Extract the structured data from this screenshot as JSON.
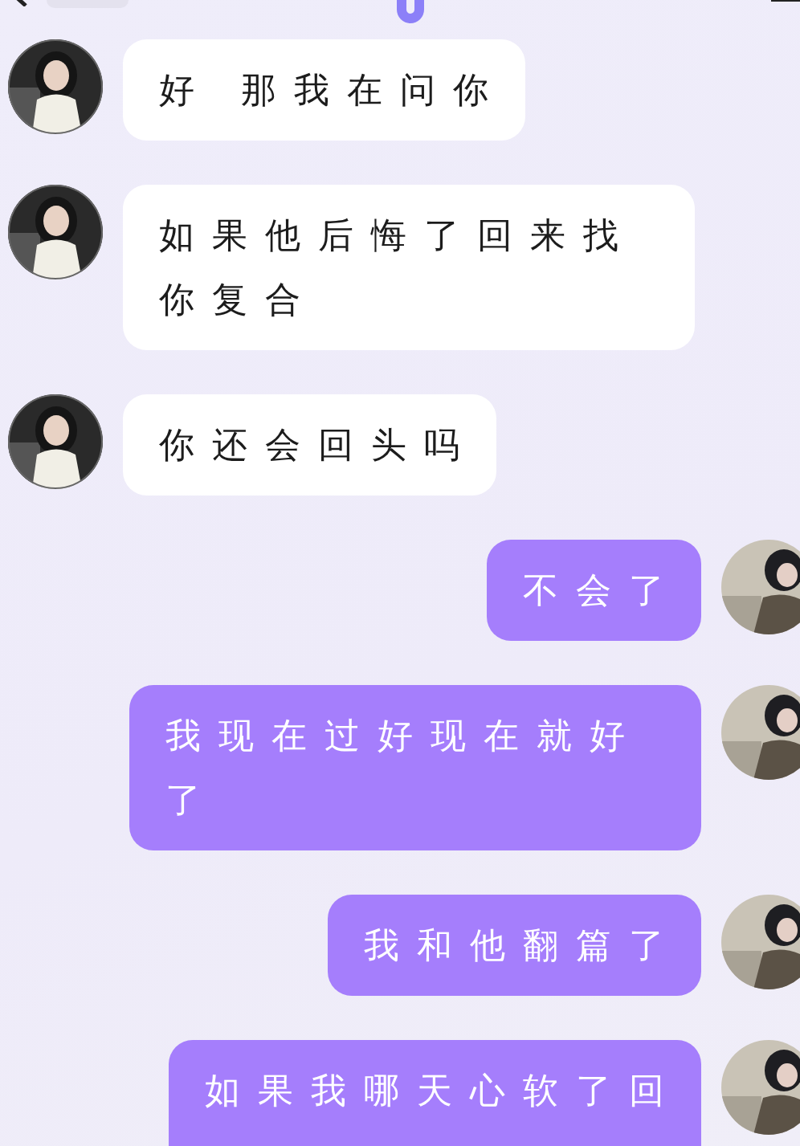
{
  "messages": [
    {
      "kind": "incoming",
      "text": "好 那我在问你",
      "cut_off": false
    },
    {
      "kind": "incoming",
      "text": "如果他后悔了回来找你复合",
      "cut_off": false
    },
    {
      "kind": "incoming",
      "text": "你还会回头吗",
      "cut_off": false
    },
    {
      "kind": "outgoing",
      "text": "不会了",
      "cut_off": false
    },
    {
      "kind": "outgoing",
      "text": "我现在过好现在就好了",
      "cut_off": false
    },
    {
      "kind": "outgoing",
      "text": "我和他翻篇了",
      "cut_off": false
    },
    {
      "kind": "outgoing",
      "text": "如果我哪天心软了回",
      "cut_off": true
    }
  ]
}
